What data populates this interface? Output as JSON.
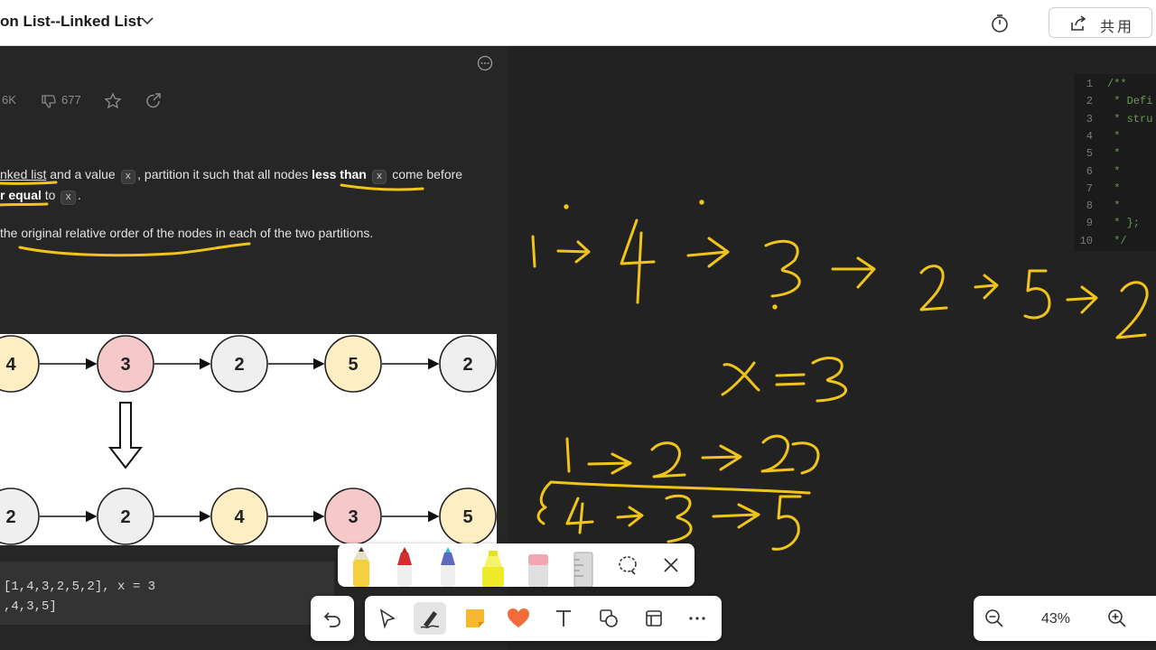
{
  "header": {
    "title": "on List--Linked List",
    "share_label": "共用"
  },
  "problem": {
    "likes": "6K",
    "dislikes": "677",
    "line1": {
      "a": "nked list",
      "b": " and a value ",
      "chip_x1": "x",
      "c": ", partition it such that all nodes ",
      "d": "less than",
      "chip_x2": "x",
      "e": " come before"
    },
    "line2": {
      "a": "r equal",
      "b": " to ",
      "chip_x3": "x",
      "c": "."
    },
    "line3": "the original relative order of the nodes in each of the two partitions.",
    "figure": {
      "top_nodes": [
        "4",
        "3",
        "2",
        "5",
        "2"
      ],
      "bottom_nodes": [
        "2",
        "2",
        "4",
        "3",
        "5"
      ],
      "node_colors": {
        "4": "#fdeec4",
        "3": "#f5c9c9",
        "2": "#efefef",
        "5": "#fdeec4"
      }
    },
    "example": {
      "line1": "[1,4,3,2,5,2], x = 3",
      "line2": ",4,3,5]"
    }
  },
  "code": {
    "lines": [
      {
        "n": "1",
        "t": "/**"
      },
      {
        "n": "2",
        "t": " * Defi"
      },
      {
        "n": "3",
        "t": " * stru"
      },
      {
        "n": "4",
        "t": " *"
      },
      {
        "n": "5",
        "t": " *"
      },
      {
        "n": "6",
        "t": " *"
      },
      {
        "n": "7",
        "t": " *"
      },
      {
        "n": "8",
        "t": " *"
      },
      {
        "n": "9",
        "t": " * };"
      },
      {
        "n": "10",
        "t": " */"
      }
    ]
  },
  "toolbar": {
    "pen_tray": [
      "pen-yellow",
      "pen-red",
      "pen-galaxy",
      "highlighter-yellow",
      "eraser",
      "ruler",
      "lasso-select",
      "close"
    ],
    "main": [
      "undo",
      "select",
      "ink-pen",
      "sticky-note",
      "heart",
      "text",
      "shapes",
      "layout",
      "more"
    ]
  },
  "zoom": {
    "level": "43%"
  },
  "ink_color": "#f0c419"
}
